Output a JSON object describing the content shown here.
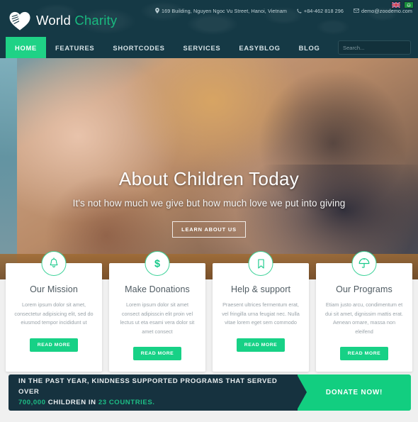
{
  "colors": {
    "header_bg": "#153945",
    "accent_green": "#17d186",
    "brand_green": "#19b97f",
    "cta_dark": "#16323f",
    "cta_green": "#12ce80",
    "page_bg": "#f0f0f0"
  },
  "header": {
    "brand": {
      "name_first": "World",
      "name_second": "Charity",
      "logo_icon": "heart-hand-logo"
    },
    "contact": {
      "address": "169 Building, Nguyen Ngoc Vu Street, Hanoi, Vietnam",
      "address_icon": "map-pin-icon",
      "phone": "+84-462 818 296",
      "phone_icon": "phone-icon",
      "email": "demo@zoodemo.com",
      "email_icon": "envelope-icon"
    },
    "languages": [
      {
        "name": "english-flag",
        "label": "English"
      },
      {
        "name": "green-flag",
        "label": "Arabic"
      }
    ]
  },
  "nav": {
    "items": [
      {
        "label": "HOME",
        "active": true
      },
      {
        "label": "FEATURES",
        "active": false
      },
      {
        "label": "SHORTCODES",
        "active": false
      },
      {
        "label": "SERVICES",
        "active": false
      },
      {
        "label": "EASYBLOG",
        "active": false
      },
      {
        "label": "BLOG",
        "active": false
      }
    ],
    "search": {
      "placeholder": "Search...",
      "value": "",
      "icon": "search-icon"
    }
  },
  "hero": {
    "title": "About Children Today",
    "subtitle": "It's not how much we give but how much love we put into giving",
    "button": "LEARN ABOUT US"
  },
  "cards": [
    {
      "icon": "bell-icon",
      "title": "Our Mission",
      "text": "Lorem ipsum dolor sit amet, consectetur adipisicing elit, sed do eiusmod tempor incididunt ut",
      "button": "READ MORE"
    },
    {
      "icon": "dollar-icon",
      "title": "Make Donations",
      "text": "Lorem ipsum dolor sit amet consect adipisscin elit proin vel lectus ut eta esami vera dolor sit amet consect",
      "button": "READ MORE"
    },
    {
      "icon": "bookmark-icon",
      "title": "Help & support",
      "text": "Praesent ultrices fermentum erat, vel fringilla urna feugiat nec. Nulla vitae lorem eget sem commodo",
      "button": "READ MORE"
    },
    {
      "icon": "umbrella-icon",
      "title": "Our Programs",
      "text": "Etiam justo arcu, condimentum et dui sit amet, dignissim mattis erat. Aenean ornare, massa non eleifend",
      "button": "READ MORE"
    }
  ],
  "cta": {
    "line1": "IN THE PAST YEAR, KINDNESS SUPPORTED PROGRAMS THAT SERVED OVER",
    "line2_number": "700,000",
    "line2_mid": " CHILDREN IN ",
    "line2_count": "23 COUNTRIES.",
    "button": "DONATE NOW!"
  }
}
